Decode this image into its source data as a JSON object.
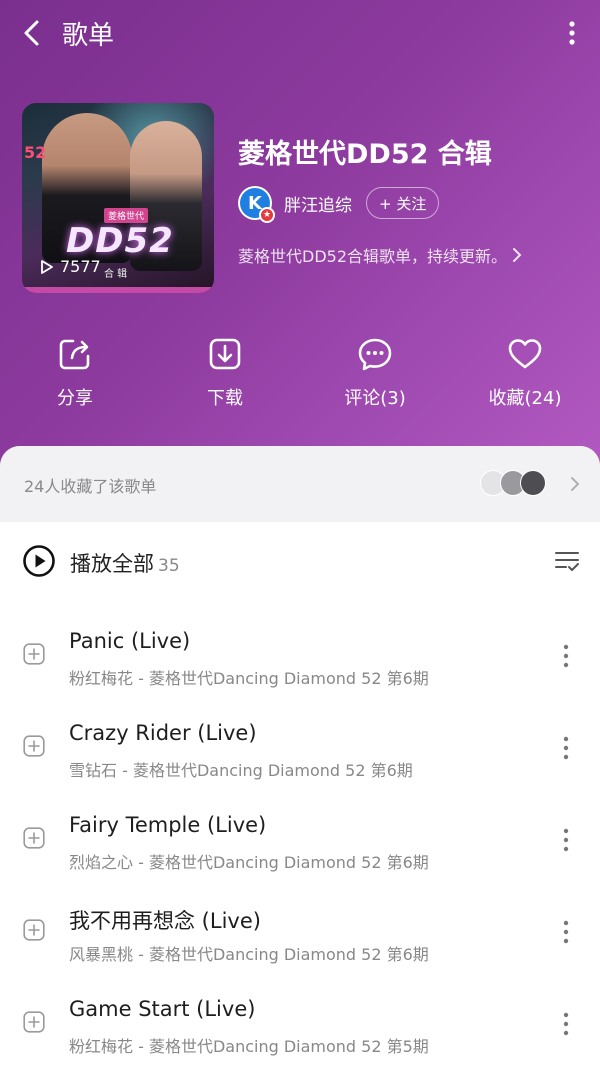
{
  "header": {
    "title": "歌单"
  },
  "cover": {
    "side_text": "52",
    "logo_text": "DD52",
    "badge_text": "菱格世代",
    "sub_text": "合 辑",
    "play_count": "7577"
  },
  "playlist": {
    "title": "菱格世代DD52 合辑",
    "creator_name": "胖汪追综",
    "creator_avatar_letter": "K",
    "follow_label": "+ 关注",
    "description": "菱格世代DD52合辑歌单，持续更新。"
  },
  "actions": [
    {
      "label": "分享",
      "icon": "share-icon"
    },
    {
      "label": "下载",
      "icon": "download-icon"
    },
    {
      "label": "评论(3)",
      "icon": "comment-icon"
    },
    {
      "label": "收藏(24)",
      "icon": "heart-icon"
    }
  ],
  "fans": {
    "text": "24人收藏了该歌单"
  },
  "play_all": {
    "label": "播放全部",
    "count": "35"
  },
  "songs": [
    {
      "title": "Panic (Live)",
      "subtitle": "粉红梅花 - 菱格世代Dancing Diamond 52 第6期"
    },
    {
      "title": "Crazy Rider (Live)",
      "subtitle": "雪钻石 - 菱格世代Dancing Diamond 52 第6期"
    },
    {
      "title": "Fairy Temple (Live)",
      "subtitle": "烈焰之心 - 菱格世代Dancing Diamond 52 第6期"
    },
    {
      "title": "我不用再想念 (Live)",
      "subtitle": "风暴黑桃 - 菱格世代Dancing Diamond 52 第6期"
    },
    {
      "title": "Game Start (Live)",
      "subtitle": "粉红梅花 - 菱格世代Dancing Diamond 52 第5期"
    }
  ],
  "colors": {
    "hero_start": "#7a2f8e",
    "hero_end": "#b259c0",
    "text_secondary": "#888888"
  }
}
